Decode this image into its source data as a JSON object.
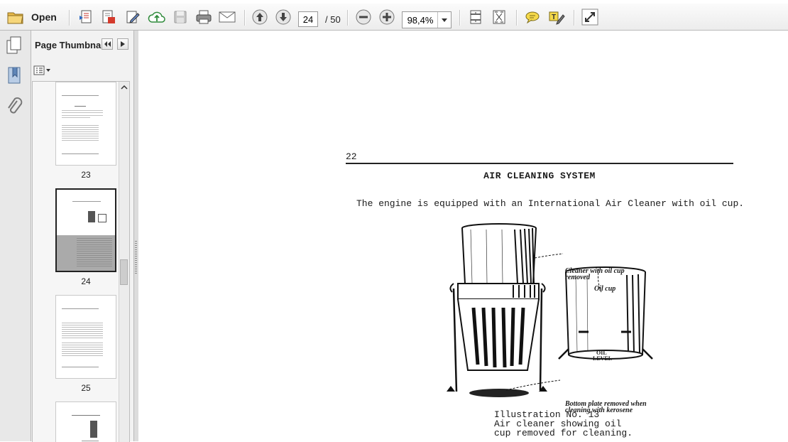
{
  "toolbar": {
    "open_label": "Open",
    "page_current": "24",
    "page_total": "/ 50",
    "zoom": "98,4%",
    "icons": [
      "folder-icon",
      "create-pdf-icon",
      "export-pdf-icon",
      "edit-pdf-icon",
      "upload-cloud-icon",
      "save-icon",
      "print-icon",
      "email-icon",
      "previous-page-icon",
      "next-page-icon",
      "zoom-out-icon",
      "zoom-in-icon",
      "fit-page-icon",
      "full-screen-fit-icon",
      "comment-icon",
      "highlight-icon",
      "expand-icon"
    ]
  },
  "panel": {
    "title": "Page Thumbna...",
    "thumbnails": [
      {
        "label": "23"
      },
      {
        "label": "24",
        "selected": true
      },
      {
        "label": "25"
      },
      {
        "label": ""
      }
    ]
  },
  "document": {
    "page_number": "22",
    "section_title": "AIR CLEANING SYSTEM",
    "intro": "The engine is equipped with an International Air Cleaner with oil cup.",
    "figure_labels": {
      "cleaner_line1": "Cleaner with oil cup",
      "cleaner_line2": "removed",
      "oil_cup": "Oil cup",
      "oil_level_1": "OIL",
      "oil_level_2": "LEVEL",
      "bottom_line1": "Bottom plate removed when",
      "bottom_line2": "cleaning with kerosene"
    },
    "caption": [
      "Illustration No. 13",
      "Air cleaner showing oil",
      "cup removed for cleaning."
    ]
  },
  "colors": {
    "toolbar_bg": "#ececec",
    "panel_bg": "#f2f2f2",
    "selection": "#222222"
  }
}
